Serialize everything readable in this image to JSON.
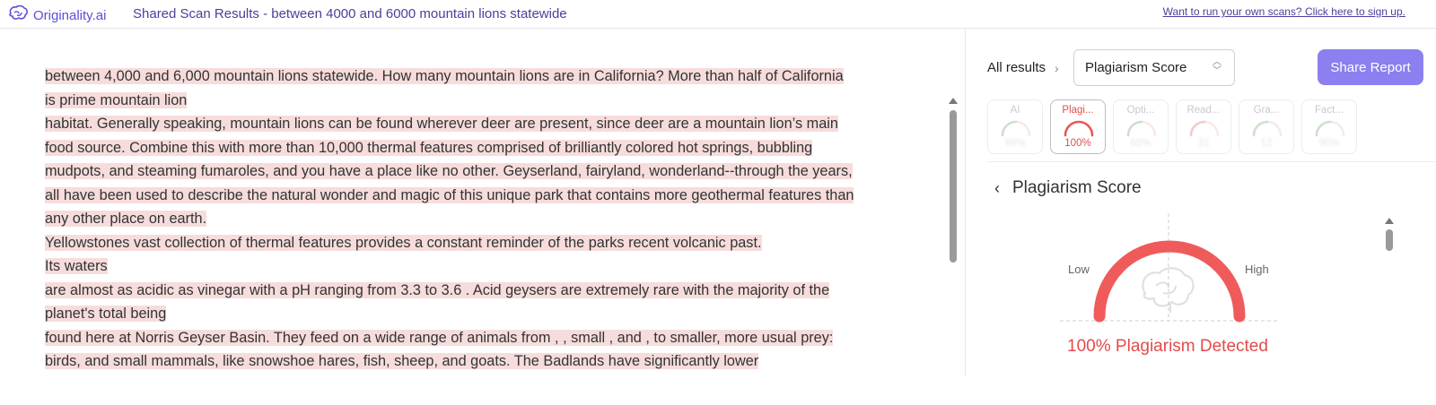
{
  "header": {
    "brand": "Originality.ai",
    "scan_title": "Shared Scan Results - between 4000 and 6000 mountain lions statewide",
    "run_link": "Want to run your own scans? Click here to sign up."
  },
  "document": {
    "paragraphs": [
      "between 4,000 and 6,000 mountain lions statewide. How many mountain lions are in California? More than half of California is prime mountain lion",
      "habitat. Generally speaking, mountain lions can be found wherever deer are present, since deer are a mountain lion’s main food source. Combine this with more than 10,000 thermal features comprised of brilliantly colored hot springs, bubbling mudpots, and steaming fumaroles, and you have a place like no other. Geyserland, fairyland, wonderland--through the years, all have been used to describe the natural wonder and magic of this unique park that contains more geothermal features than any other place on earth.",
      "Yellowstones vast collection of thermal features provides a constant reminder of the parks recent volcanic past.",
      "Its waters",
      "are almost as acidic as vinegar with a pH ranging from 3.3 to 3.6 .  Acid geysers are extremely rare with the majority of the planet's total being",
      "found here at Norris Geyser Basin. They feed on a wide range of animals from , , small , and , to smaller, more usual prey: birds, and small mammals, like snowshoe hares, fish, sheep, and goats. The Badlands have significantly lower"
    ]
  },
  "panel": {
    "breadcrumb": "All results",
    "select_value": "Plagiarism Score",
    "share_label": "Share Report",
    "cards": [
      {
        "label": "AI",
        "value": "99%",
        "color": "#7fd19b"
      },
      {
        "label": "Plagi...",
        "value": "100%",
        "color": "#e9585a"
      },
      {
        "label": "Opti...",
        "value": "60%",
        "color": "#7fd19b"
      },
      {
        "label": "Read...",
        "value": "31",
        "color": "#f08f8f"
      },
      {
        "label": "Gra...",
        "value": "12",
        "color": "#7fd19b"
      },
      {
        "label": "Fact...",
        "value": "90%",
        "color": "#7fd19b"
      }
    ],
    "section_title": "Plagiarism Score",
    "gauge": {
      "low": "Low",
      "high": "High",
      "value_pct": 100,
      "color": "#ef5b5b"
    },
    "result_text": "100% Plagiarism Detected"
  }
}
